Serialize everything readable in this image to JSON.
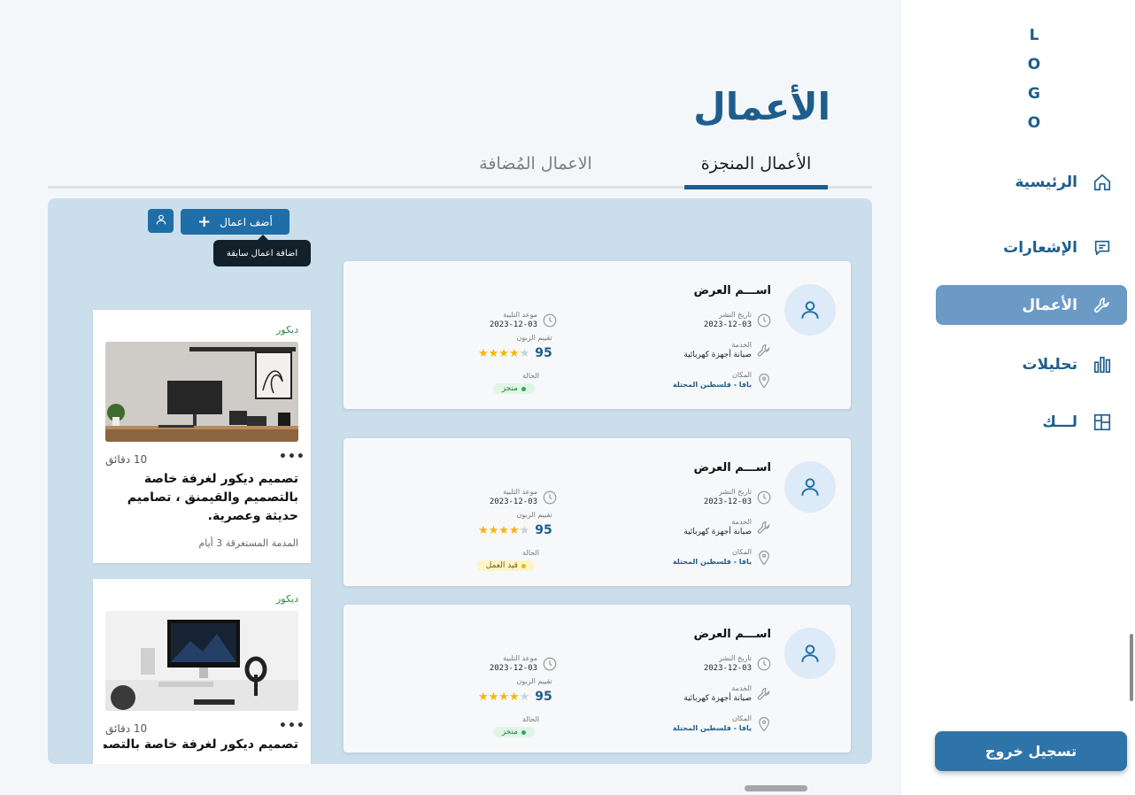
{
  "sidebar": {
    "logo": "L O G O",
    "logo_letters": [
      "L",
      "O",
      "G",
      "O"
    ],
    "items": [
      {
        "label": "الرئيسية",
        "icon": "home-icon",
        "active": false
      },
      {
        "label": "الإشعارات",
        "icon": "message-icon",
        "active": false
      },
      {
        "label": "الأعمال",
        "icon": "wrench-icon",
        "active": true
      },
      {
        "label": "تحليلات",
        "icon": "chart-bars-icon",
        "active": false
      },
      {
        "label": "لـــك",
        "icon": "layout-icon",
        "active": false
      }
    ],
    "logout_label": "تسجيل خروج"
  },
  "header": {
    "title": "الأعمال",
    "tabs": [
      {
        "label": "الأعمال المنجزة",
        "active": true
      },
      {
        "label": "الاعمال المُضافة",
        "active": false
      }
    ]
  },
  "toolbar": {
    "add_label": "أضف اعمال",
    "tooltip": "اضافة اعمال سابقة"
  },
  "decor_cards": [
    {
      "category": "ديكور",
      "time": "10 دقائق",
      "description": "تصميم ديكور لغرفة خاصة بالتصميم والقيمنق ، تصاميم حديثة وعصرية.",
      "duration": "المدمة المستغرقة 3 أيام"
    },
    {
      "category": "ديكور",
      "time": "10 دقائق",
      "description": "تصميم ديكور لغرفة خاصة بالتصميم..."
    }
  ],
  "jobs": [
    {
      "name": "اســـم العرض",
      "publish_label": "تاريخ النشر",
      "publish_date": "2023-12-03",
      "deadline_label": "موعد التلبية",
      "deadline_date": "2023-12-03",
      "service_label": "الخدمة",
      "service": "صيانة أجهزة كهربائية",
      "rating_label": "تقييم الزبون",
      "rating": "95",
      "stars": 4,
      "place_label": "المكان",
      "place": "يافا - فلسطين المحتلة",
      "status_label": "الحالة",
      "status": "منجز",
      "status_type": "done"
    },
    {
      "name": "اســـم العرض",
      "publish_label": "تاريخ النشر",
      "publish_date": "2023-12-03",
      "deadline_label": "موعد التلبية",
      "deadline_date": "2023-12-03",
      "service_label": "الخدمة",
      "service": "صيانة أجهزة كهربائية",
      "rating_label": "تقييم الزبون",
      "rating": "95",
      "stars": 4,
      "place_label": "المكان",
      "place": "يافا - فلسطين المحتلة",
      "status_label": "الحالة",
      "status": "قيد العمل",
      "status_type": "progress"
    },
    {
      "name": "اســـم العرض",
      "publish_label": "تاريخ النشر",
      "publish_date": "2023-12-03",
      "deadline_label": "موعد التلبية",
      "deadline_date": "2023-12-03",
      "service_label": "الخدمة",
      "service": "صيانة أجهزة كهربائية",
      "rating_label": "تقييم الزبون",
      "rating": "95",
      "stars": 4,
      "place_label": "المكان",
      "place": "يافا - فلسطين المحتلة",
      "status_label": "الحالة",
      "status": "منجز",
      "status_type": "done"
    }
  ],
  "colors": {
    "brand": "#1e5e8c",
    "accent": "#2f74a8",
    "panel": "#cbdeec",
    "active_nav": "#6b9ac4"
  }
}
